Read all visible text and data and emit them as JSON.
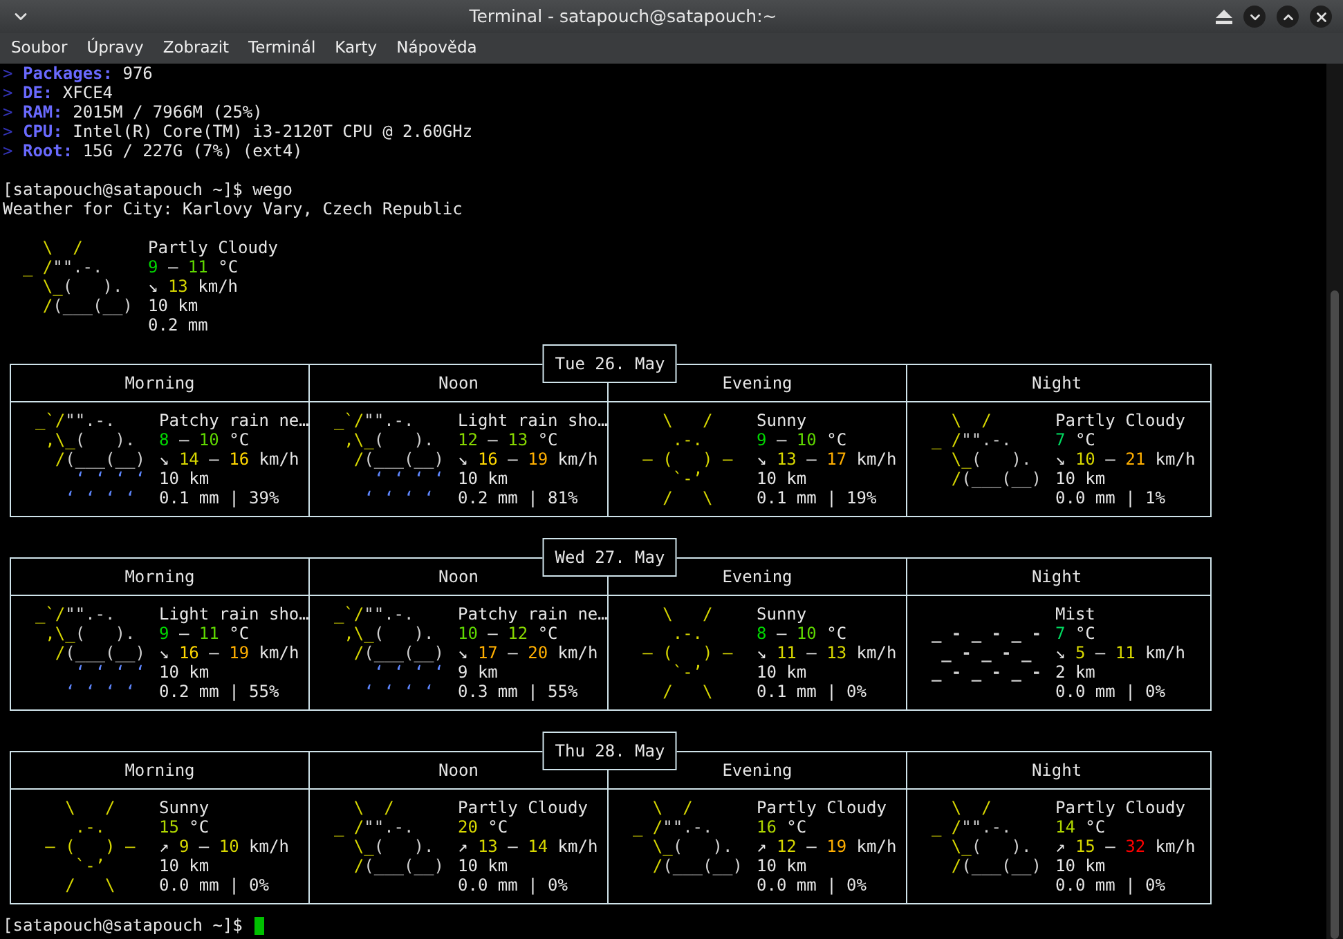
{
  "window": {
    "title": "Terminal - satapouch@satapouch:~"
  },
  "menu": [
    "Soubor",
    "Úpravy",
    "Zobrazit",
    "Terminál",
    "Karty",
    "Nápověda"
  ],
  "sysinfo": [
    {
      "marker": ">",
      "label": "Packages:",
      "value": "976"
    },
    {
      "marker": ">",
      "label": "DE:",
      "value": "XFCE4"
    },
    {
      "marker": ">",
      "label": "RAM:",
      "value": "2015M / 7966M (25%)"
    },
    {
      "marker": ">",
      "label": "CPU:",
      "value": "Intel(R) Core(TM) i3-2120T CPU @ 2.60GHz"
    },
    {
      "marker": ">",
      "label": "Root:",
      "value": "15G / 227G (7%) (ext4)"
    }
  ],
  "command_line": {
    "prompt": "[satapouch@satapouch ~]$",
    "command": "wego"
  },
  "location": "Weather for City: Karlovy Vary, Czech Republic",
  "current": {
    "art": {
      "kind": "cloudy",
      "lines": [
        [
          {
            "text": "    \\  /",
            "color": "#d7d700"
          }
        ],
        [
          {
            "text": "  _ /",
            "color": "#d7d700"
          },
          {
            "text": "\"\".-.",
            "color": "#d0d0d0"
          }
        ],
        [
          {
            "text": "    \\_",
            "color": "#d7d700"
          },
          {
            "text": "(   ).",
            "color": "#d0d0d0"
          }
        ],
        [
          {
            "text": "    /",
            "color": "#d7d700"
          },
          {
            "text": "(___(__)",
            "color": "#d0d0d0"
          }
        ]
      ]
    },
    "condition": "Partly Cloudy",
    "temperature": [
      {
        "text": "9",
        "color": "#00d700"
      },
      {
        "text": " – "
      },
      {
        "text": "11",
        "color": "#5fd700"
      },
      {
        "text": " °C"
      }
    ],
    "wind": [
      {
        "text": "↘ "
      },
      {
        "text": "13",
        "color": "#d7d700"
      },
      {
        "text": " km/h"
      }
    ],
    "visibility": "10 km",
    "precipitation": "0.2 mm"
  },
  "days": [
    {
      "date": "Tue 26. May",
      "slots": [
        {
          "period": "Morning",
          "art": {
            "kind": "showers",
            "lines": [
              [
                {
                  "text": "  _`/",
                  "color": "#d7d700"
                },
                {
                  "text": "\"\".-.",
                  "color": "#d0d0d0"
                }
              ],
              [
                {
                  "text": "   ,\\_",
                  "color": "#d7d700"
                },
                {
                  "text": "(   ).",
                  "color": "#d0d0d0"
                }
              ],
              [
                {
                  "text": "    /",
                  "color": "#d7d700"
                },
                {
                  "text": "(___(__)",
                  "color": "#d0d0d0"
                }
              ],
              [
                {
                  "text": "      ‘ ‘ ‘ ‘",
                  "color": "#5f87ff"
                }
              ],
              [
                {
                  "text": "     ‘ ‘ ‘ ‘",
                  "color": "#5f87ff"
                }
              ]
            ]
          },
          "condition": "Patchy rain ne…",
          "temperature": [
            {
              "text": "8",
              "color": "#00d700"
            },
            {
              "text": " – "
            },
            {
              "text": "10",
              "color": "#5fd700"
            },
            {
              "text": " °C"
            }
          ],
          "wind": [
            {
              "text": "↘ "
            },
            {
              "text": "14",
              "color": "#d7d700"
            },
            {
              "text": " – "
            },
            {
              "text": "16",
              "color": "#ffd700"
            },
            {
              "text": " km/h"
            }
          ],
          "visibility": "10 km",
          "precipitation": "0.1 mm | 39%"
        },
        {
          "period": "Noon",
          "art": {
            "kind": "showers",
            "lines": [
              [
                {
                  "text": "  _`/",
                  "color": "#d7d700"
                },
                {
                  "text": "\"\".-.",
                  "color": "#d0d0d0"
                }
              ],
              [
                {
                  "text": "   ,\\_",
                  "color": "#d7d700"
                },
                {
                  "text": "(   ).",
                  "color": "#d0d0d0"
                }
              ],
              [
                {
                  "text": "    /",
                  "color": "#d7d700"
                },
                {
                  "text": "(___(__)",
                  "color": "#d0d0d0"
                }
              ],
              [
                {
                  "text": "      ‘ ‘ ‘ ‘",
                  "color": "#5f87ff"
                }
              ],
              [
                {
                  "text": "     ‘ ‘ ‘ ‘",
                  "color": "#5f87ff"
                }
              ]
            ]
          },
          "condition": "Light rain sho…",
          "temperature": [
            {
              "text": "12",
              "color": "#87d700"
            },
            {
              "text": " – "
            },
            {
              "text": "13",
              "color": "#87d700"
            },
            {
              "text": " °C"
            }
          ],
          "wind": [
            {
              "text": "↘ "
            },
            {
              "text": "16",
              "color": "#ffd700"
            },
            {
              "text": " – "
            },
            {
              "text": "19",
              "color": "#ffaf00"
            },
            {
              "text": " km/h"
            }
          ],
          "visibility": "10 km",
          "precipitation": "0.2 mm | 81%"
        },
        {
          "period": "Evening",
          "art": {
            "kind": "sunny",
            "lines": [
              [
                {
                  "text": "     \\   /",
                  "color": "#d7d700"
                }
              ],
              [
                {
                  "text": "      .-.",
                  "color": "#d7d700"
                }
              ],
              [
                {
                  "text": "   ― (   ) ―",
                  "color": "#d7d700"
                }
              ],
              [
                {
                  "text": "      `-’",
                  "color": "#d7d700"
                }
              ],
              [
                {
                  "text": "     /   \\",
                  "color": "#d7d700"
                }
              ]
            ]
          },
          "condition": "Sunny",
          "temperature": [
            {
              "text": "9",
              "color": "#00d700"
            },
            {
              "text": " – "
            },
            {
              "text": "10",
              "color": "#5fd700"
            },
            {
              "text": " °C"
            }
          ],
          "wind": [
            {
              "text": "↘ "
            },
            {
              "text": "13",
              "color": "#d7d700"
            },
            {
              "text": " – "
            },
            {
              "text": "17",
              "color": "#ffaf00"
            },
            {
              "text": " km/h"
            }
          ],
          "visibility": "10 km",
          "precipitation": "0.1 mm | 19%"
        },
        {
          "period": "Night",
          "art": {
            "kind": "cloudy",
            "lines": [
              [
                {
                  "text": "    \\  /",
                  "color": "#d7d700"
                }
              ],
              [
                {
                  "text": "  _ /",
                  "color": "#d7d700"
                },
                {
                  "text": "\"\".-.",
                  "color": "#d0d0d0"
                }
              ],
              [
                {
                  "text": "    \\_",
                  "color": "#d7d700"
                },
                {
                  "text": "(   ).",
                  "color": "#d0d0d0"
                }
              ],
              [
                {
                  "text": "    /",
                  "color": "#d7d700"
                },
                {
                  "text": "(___(__)",
                  "color": "#d0d0d0"
                }
              ]
            ]
          },
          "condition": "Partly Cloudy",
          "temperature": [
            {
              "text": "7",
              "color": "#00d75f"
            },
            {
              "text": " °C"
            }
          ],
          "wind": [
            {
              "text": "↘ "
            },
            {
              "text": "10",
              "color": "#d7d700"
            },
            {
              "text": " – "
            },
            {
              "text": "21",
              "color": "#ffaf00"
            },
            {
              "text": " km/h"
            }
          ],
          "visibility": "10 km",
          "precipitation": "0.0 mm | 1%"
        }
      ]
    },
    {
      "date": "Wed 27. May",
      "slots": [
        {
          "period": "Morning",
          "art": {
            "kind": "showers",
            "lines": [
              [
                {
                  "text": "  _`/",
                  "color": "#d7d700"
                },
                {
                  "text": "\"\".-.",
                  "color": "#d0d0d0"
                }
              ],
              [
                {
                  "text": "   ,\\_",
                  "color": "#d7d700"
                },
                {
                  "text": "(   ).",
                  "color": "#d0d0d0"
                }
              ],
              [
                {
                  "text": "    /",
                  "color": "#d7d700"
                },
                {
                  "text": "(___(__)",
                  "color": "#d0d0d0"
                }
              ],
              [
                {
                  "text": "      ‘ ‘ ‘ ‘",
                  "color": "#5f87ff"
                }
              ],
              [
                {
                  "text": "     ‘ ‘ ‘ ‘",
                  "color": "#5f87ff"
                }
              ]
            ]
          },
          "condition": "Light rain sho…",
          "temperature": [
            {
              "text": "9",
              "color": "#00d700"
            },
            {
              "text": " – "
            },
            {
              "text": "11",
              "color": "#5fd700"
            },
            {
              "text": " °C"
            }
          ],
          "wind": [
            {
              "text": "↘ "
            },
            {
              "text": "16",
              "color": "#ffd700"
            },
            {
              "text": " – "
            },
            {
              "text": "19",
              "color": "#ffaf00"
            },
            {
              "text": " km/h"
            }
          ],
          "visibility": "10 km",
          "precipitation": "0.2 mm | 55%"
        },
        {
          "period": "Noon",
          "art": {
            "kind": "showers",
            "lines": [
              [
                {
                  "text": "  _`/",
                  "color": "#d7d700"
                },
                {
                  "text": "\"\".-.",
                  "color": "#d0d0d0"
                }
              ],
              [
                {
                  "text": "   ,\\_",
                  "color": "#d7d700"
                },
                {
                  "text": "(   ).",
                  "color": "#d0d0d0"
                }
              ],
              [
                {
                  "text": "    /",
                  "color": "#d7d700"
                },
                {
                  "text": "(___(__)",
                  "color": "#d0d0d0"
                }
              ],
              [
                {
                  "text": "      ‘ ‘ ‘ ‘",
                  "color": "#5f87ff"
                }
              ],
              [
                {
                  "text": "     ‘ ‘ ‘ ‘",
                  "color": "#5f87ff"
                }
              ]
            ]
          },
          "condition": "Patchy rain ne…",
          "temperature": [
            {
              "text": "10",
              "color": "#5fd700"
            },
            {
              "text": " – "
            },
            {
              "text": "12",
              "color": "#87d700"
            },
            {
              "text": " °C"
            }
          ],
          "wind": [
            {
              "text": "↘ "
            },
            {
              "text": "17",
              "color": "#ffaf00"
            },
            {
              "text": " – "
            },
            {
              "text": "20",
              "color": "#ffaf00"
            },
            {
              "text": " km/h"
            }
          ],
          "visibility": "9 km",
          "precipitation": "0.3 mm | 55%"
        },
        {
          "period": "Evening",
          "art": {
            "kind": "sunny",
            "lines": [
              [
                {
                  "text": "     \\   /",
                  "color": "#d7d700"
                }
              ],
              [
                {
                  "text": "      .-.",
                  "color": "#d7d700"
                }
              ],
              [
                {
                  "text": "   ― (   ) ―",
                  "color": "#d7d700"
                }
              ],
              [
                {
                  "text": "      `-’",
                  "color": "#d7d700"
                }
              ],
              [
                {
                  "text": "     /   \\",
                  "color": "#d7d700"
                }
              ]
            ]
          },
          "condition": "Sunny",
          "temperature": [
            {
              "text": "8",
              "color": "#00d700"
            },
            {
              "text": " – "
            },
            {
              "text": "10",
              "color": "#5fd700"
            },
            {
              "text": " °C"
            }
          ],
          "wind": [
            {
              "text": "↘ "
            },
            {
              "text": "11",
              "color": "#d7d700"
            },
            {
              "text": " – "
            },
            {
              "text": "13",
              "color": "#d7d700"
            },
            {
              "text": " km/h"
            }
          ],
          "visibility": "10 km",
          "precipitation": "0.1 mm | 0%"
        },
        {
          "period": "Night",
          "art": {
            "kind": "fog",
            "lines": [
              [
                {
                  "text": "  _ - _ - _ -",
                  "color": "#d0d0d0"
                }
              ],
              [
                {
                  "text": "   _ - _ - _",
                  "color": "#d0d0d0"
                }
              ],
              [
                {
                  "text": "  _ - _ - _ -",
                  "color": "#d0d0d0"
                }
              ]
            ]
          },
          "condition": "Mist",
          "temperature": [
            {
              "text": "7",
              "color": "#00d75f"
            },
            {
              "text": " °C"
            }
          ],
          "wind": [
            {
              "text": "↘ "
            },
            {
              "text": "5",
              "color": "#d7d700"
            },
            {
              "text": " – "
            },
            {
              "text": "11",
              "color": "#d7d700"
            },
            {
              "text": " km/h"
            }
          ],
          "visibility": "2 km",
          "precipitation": "0.0 mm | 0%"
        }
      ]
    },
    {
      "date": "Thu 28. May",
      "slots": [
        {
          "period": "Morning",
          "art": {
            "kind": "sunny",
            "lines": [
              [
                {
                  "text": "     \\   /",
                  "color": "#d7d700"
                }
              ],
              [
                {
                  "text": "      .-.",
                  "color": "#d7d700"
                }
              ],
              [
                {
                  "text": "   ― (   ) ―",
                  "color": "#d7d700"
                }
              ],
              [
                {
                  "text": "      `-’",
                  "color": "#d7d700"
                }
              ],
              [
                {
                  "text": "     /   \\",
                  "color": "#d7d700"
                }
              ]
            ]
          },
          "condition": "Sunny",
          "temperature": [
            {
              "text": "15",
              "color": "#afd700"
            },
            {
              "text": " °C"
            }
          ],
          "wind": [
            {
              "text": "↗ "
            },
            {
              "text": "9",
              "color": "#d7d700"
            },
            {
              "text": " – "
            },
            {
              "text": "10",
              "color": "#d7d700"
            },
            {
              "text": " km/h"
            }
          ],
          "visibility": "10 km",
          "precipitation": "0.0 mm | 0%"
        },
        {
          "period": "Noon",
          "art": {
            "kind": "cloudy",
            "lines": [
              [
                {
                  "text": "    \\  /",
                  "color": "#d7d700"
                }
              ],
              [
                {
                  "text": "  _ /",
                  "color": "#d7d700"
                },
                {
                  "text": "\"\".-.",
                  "color": "#d0d0d0"
                }
              ],
              [
                {
                  "text": "    \\_",
                  "color": "#d7d700"
                },
                {
                  "text": "(   ).",
                  "color": "#d0d0d0"
                }
              ],
              [
                {
                  "text": "    /",
                  "color": "#d7d700"
                },
                {
                  "text": "(___(__)",
                  "color": "#d0d0d0"
                }
              ]
            ]
          },
          "condition": "Partly Cloudy",
          "temperature": [
            {
              "text": "20",
              "color": "#d7d700"
            },
            {
              "text": " °C"
            }
          ],
          "wind": [
            {
              "text": "↗ "
            },
            {
              "text": "13",
              "color": "#d7d700"
            },
            {
              "text": " – "
            },
            {
              "text": "14",
              "color": "#d7d700"
            },
            {
              "text": " km/h"
            }
          ],
          "visibility": "10 km",
          "precipitation": "0.0 mm | 0%"
        },
        {
          "period": "Evening",
          "art": {
            "kind": "cloudy",
            "lines": [
              [
                {
                  "text": "    \\  /",
                  "color": "#d7d700"
                }
              ],
              [
                {
                  "text": "  _ /",
                  "color": "#d7d700"
                },
                {
                  "text": "\"\".-.",
                  "color": "#d0d0d0"
                }
              ],
              [
                {
                  "text": "    \\_",
                  "color": "#d7d700"
                },
                {
                  "text": "(   ).",
                  "color": "#d0d0d0"
                }
              ],
              [
                {
                  "text": "    /",
                  "color": "#d7d700"
                },
                {
                  "text": "(___(__)",
                  "color": "#d0d0d0"
                }
              ]
            ]
          },
          "condition": "Partly Cloudy",
          "temperature": [
            {
              "text": "16",
              "color": "#afd700"
            },
            {
              "text": " °C"
            }
          ],
          "wind": [
            {
              "text": "↗ "
            },
            {
              "text": "12",
              "color": "#d7d700"
            },
            {
              "text": " – "
            },
            {
              "text": "19",
              "color": "#ffaf00"
            },
            {
              "text": " km/h"
            }
          ],
          "visibility": "10 km",
          "precipitation": "0.0 mm | 0%"
        },
        {
          "period": "Night",
          "art": {
            "kind": "cloudy",
            "lines": [
              [
                {
                  "text": "    \\  /",
                  "color": "#d7d700"
                }
              ],
              [
                {
                  "text": "  _ /",
                  "color": "#d7d700"
                },
                {
                  "text": "\"\".-.",
                  "color": "#d0d0d0"
                }
              ],
              [
                {
                  "text": "    \\_",
                  "color": "#d7d700"
                },
                {
                  "text": "(   ).",
                  "color": "#d0d0d0"
                }
              ],
              [
                {
                  "text": "    /",
                  "color": "#d7d700"
                },
                {
                  "text": "(___(__)",
                  "color": "#d0d0d0"
                }
              ]
            ]
          },
          "condition": "Partly Cloudy",
          "temperature": [
            {
              "text": "14",
              "color": "#afd700"
            },
            {
              "text": " °C"
            }
          ],
          "wind": [
            {
              "text": "↗ "
            },
            {
              "text": "15",
              "color": "#d7d700"
            },
            {
              "text": " – "
            },
            {
              "text": "32",
              "color": "#ff0000"
            },
            {
              "text": " km/h"
            }
          ],
          "visibility": "10 km",
          "precipitation": "0.0 mm | 0%"
        }
      ]
    }
  ],
  "final_prompt": {
    "prompt": "[satapouch@satapouch ~]$",
    "cursor_visible": true
  }
}
